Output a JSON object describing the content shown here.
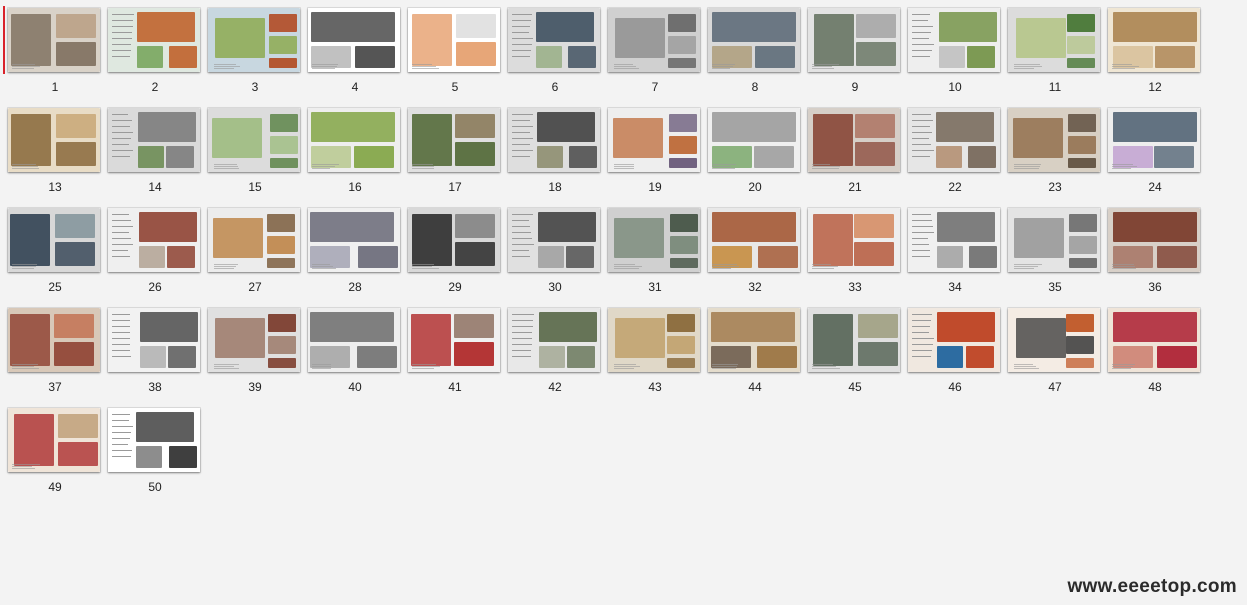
{
  "thumbnails": [
    {
      "label": "1",
      "selected": true,
      "palette": [
        "#7a6a5a",
        "#b79a7d",
        "#d9d2c8"
      ]
    },
    {
      "label": "2",
      "palette": [
        "#c0642e",
        "#7aa860",
        "#dfe8e0"
      ]
    },
    {
      "label": "3",
      "palette": [
        "#b3502a",
        "#8aa84a",
        "#c8d7e0"
      ]
    },
    {
      "label": "4",
      "palette": [
        "#444444",
        "#bbbbbb",
        "#ffffff"
      ]
    },
    {
      "label": "5",
      "palette": [
        "#e6a070",
        "#dcdcdc",
        "#ffffff"
      ]
    },
    {
      "label": "6",
      "palette": [
        "#4a5a68",
        "#9bb08a",
        "#dcdcdc"
      ]
    },
    {
      "label": "7",
      "palette": [
        "#6b6b6b",
        "#9a9a9a",
        "#d0d0d0"
      ]
    },
    {
      "label": "8",
      "palette": [
        "#5d6b78",
        "#b0a080",
        "#d9d9d9"
      ]
    },
    {
      "label": "9",
      "palette": [
        "#5f6d5a",
        "#a3a3a3",
        "#e3e3e3"
      ]
    },
    {
      "label": "10",
      "palette": [
        "#6f8f40",
        "#c0c0c0",
        "#eeeeee"
      ]
    },
    {
      "label": "11",
      "palette": [
        "#4c7a3a",
        "#b5c58a",
        "#dcdcdc"
      ]
    },
    {
      "label": "12",
      "palette": [
        "#b08a5a",
        "#d8c09a",
        "#efe6d4"
      ]
    },
    {
      "label": "13",
      "palette": [
        "#8a6a3c",
        "#c9a878",
        "#e8dcc6"
      ]
    },
    {
      "label": "14",
      "palette": [
        "#7a7a7a",
        "#6a8a50",
        "#dadada"
      ]
    },
    {
      "label": "15",
      "palette": [
        "#4d7a36",
        "#9aba7a",
        "#dcdcdc"
      ]
    },
    {
      "label": "16",
      "palette": [
        "#7ba03a",
        "#b8c890",
        "#eeeeee"
      ]
    },
    {
      "label": "17",
      "palette": [
        "#556b3a",
        "#8a7a5a",
        "#e0e0e0"
      ]
    },
    {
      "label": "18",
      "palette": [
        "#4a4a4a",
        "#8a8a6a",
        "#dedede"
      ]
    },
    {
      "label": "19",
      "palette": [
        "#6a5a7a",
        "#c07040",
        "#eeeeee"
      ]
    },
    {
      "label": "20",
      "palette": [
        "#9a9a9a",
        "#7aa86a",
        "#efefef"
      ]
    },
    {
      "label": "21",
      "palette": [
        "#8a4a3a",
        "#b07a6a",
        "#d6cfc8"
      ]
    },
    {
      "label": "22",
      "palette": [
        "#6a5a4a",
        "#b08a6a",
        "#e6e6e6"
      ]
    },
    {
      "label": "23",
      "palette": [
        "#5a4a3a",
        "#9a7a5a",
        "#d8d0c4"
      ]
    },
    {
      "label": "24",
      "palette": [
        "#5a6a7a",
        "#c0a0d0",
        "#eeeeee"
      ]
    },
    {
      "label": "25",
      "palette": [
        "#3a4a5a",
        "#8a9aa0",
        "#d8d8d8"
      ]
    },
    {
      "label": "26",
      "palette": [
        "#8a3a2a",
        "#b0a090",
        "#efefef"
      ]
    },
    {
      "label": "27",
      "palette": [
        "#7a5a3a",
        "#c08a50",
        "#ececec"
      ]
    },
    {
      "label": "28",
      "palette": [
        "#5a5a6a",
        "#a0a0b0",
        "#f0f0f0"
      ]
    },
    {
      "label": "29",
      "palette": [
        "#3a3a3a",
        "#8a8a8a",
        "#d8d8d8"
      ]
    },
    {
      "label": "30",
      "palette": [
        "#4a4a4a",
        "#9a9a9a",
        "#e0e0e0"
      ]
    },
    {
      "label": "31",
      "palette": [
        "#3a4a3a",
        "#7a8a7a",
        "#d0d0d0"
      ]
    },
    {
      "label": "32",
      "palette": [
        "#a0502a",
        "#c0802a",
        "#e8e8e8"
      ]
    },
    {
      "label": "33",
      "palette": [
        "#b04a2a",
        "#d07a4a",
        "#eeeeee"
      ]
    },
    {
      "label": "34",
      "palette": [
        "#5a5a5a",
        "#9a9a9a",
        "#f0f0f0"
      ]
    },
    {
      "label": "35",
      "palette": [
        "#6a6a6a",
        "#a0a0a0",
        "#e4e4e4"
      ]
    },
    {
      "label": "36",
      "palette": [
        "#7a3a2a",
        "#a06a5a",
        "#d8d0c8"
      ]
    },
    {
      "label": "37",
      "palette": [
        "#8a3a2a",
        "#c06a4a",
        "#d8c8b8"
      ]
    },
    {
      "label": "38",
      "palette": [
        "#4a4a4a",
        "#aaaaaa",
        "#f2f2f2"
      ]
    },
    {
      "label": "39",
      "palette": [
        "#7a3a2a",
        "#a08070",
        "#e0e0e0"
      ]
    },
    {
      "label": "40",
      "palette": [
        "#5a5a5a",
        "#9a9a9a",
        "#eeeeee"
      ]
    },
    {
      "label": "41",
      "palette": [
        "#b02a2a",
        "#8a6a5a",
        "#f0f0f0"
      ]
    },
    {
      "label": "42",
      "palette": [
        "#5a6a4a",
        "#9aa08a",
        "#e8e8e8"
      ]
    },
    {
      "label": "43",
      "palette": [
        "#8a6a3a",
        "#c0a06a",
        "#e0d8c8"
      ]
    },
    {
      "label": "44",
      "palette": [
        "#a07a4a",
        "#7a6a5a",
        "#e4dccc"
      ]
    },
    {
      "label": "45",
      "palette": [
        "#4a5a4a",
        "#9a9a7a",
        "#e0e0e0"
      ]
    },
    {
      "label": "46",
      "palette": [
        "#c04a2a",
        "#2a6aa0",
        "#f0e8e0"
      ]
    },
    {
      "label": "47",
      "palette": [
        "#c05a2a",
        "#3a3a3a",
        "#f4ece4"
      ]
    },
    {
      "label": "48",
      "palette": [
        "#b02a3a",
        "#d08a7a",
        "#efe4d8"
      ]
    },
    {
      "label": "49",
      "palette": [
        "#b03a3a",
        "#c0a07a",
        "#efe4d8"
      ]
    },
    {
      "label": "50",
      "palette": [
        "#3a3a3a",
        "#8a8a8a",
        "#ffffff"
      ]
    }
  ],
  "watermark": "www.eeeetop.com"
}
